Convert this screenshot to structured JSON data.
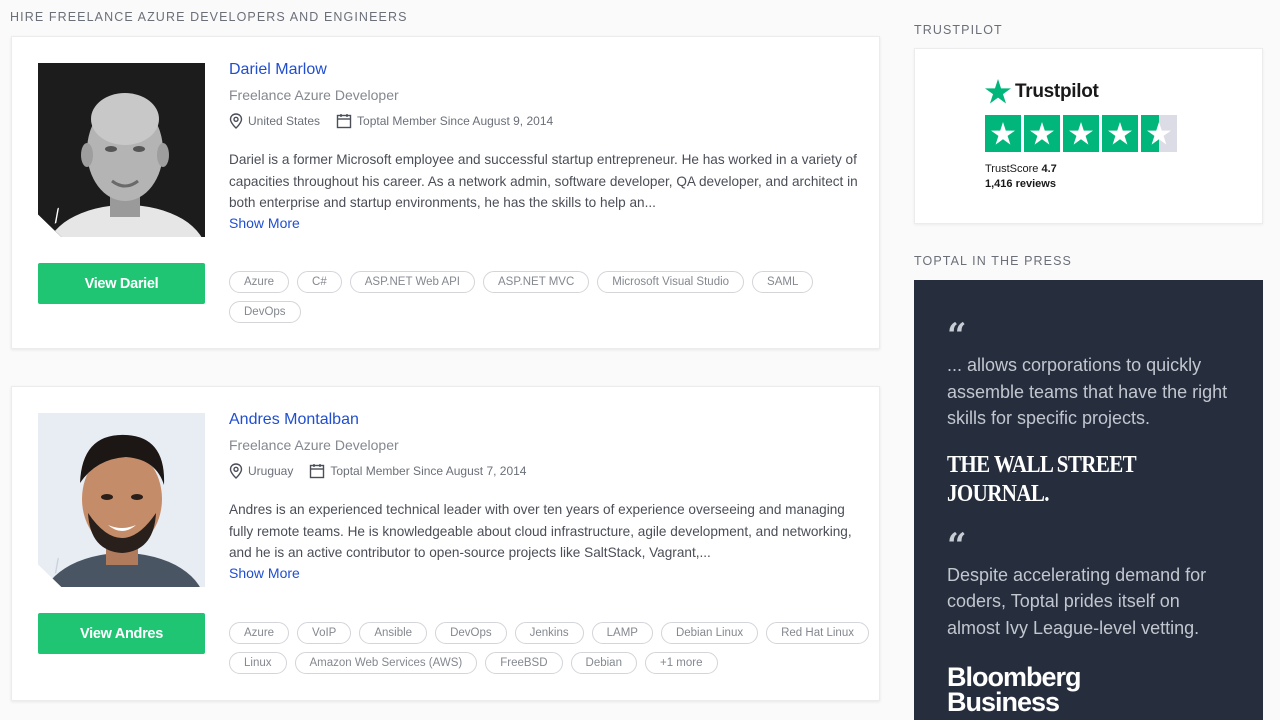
{
  "section_title": "HIRE FREELANCE AZURE DEVELOPERS AND ENGINEERS",
  "developers": [
    {
      "name": "Dariel Marlow",
      "role": "Freelance Azure Developer",
      "location": "United States",
      "member_since": "Toptal Member Since August 9, 2014",
      "description": "Dariel is a former Microsoft employee and successful startup entrepreneur. He has worked in a variety of capacities throughout his career. As a network admin, software developer, QA developer, and architect in both enterprise and startup environments, he has the skills to help an...",
      "show_more": "Show More",
      "button": "View Dariel",
      "skills": [
        "Azure",
        "C#",
        "ASP.NET Web API",
        "ASP.NET MVC",
        "Microsoft Visual Studio",
        "SAML",
        "DevOps"
      ]
    },
    {
      "name": "Andres Montalban",
      "role": "Freelance Azure Developer",
      "location": "Uruguay",
      "member_since": "Toptal Member Since August 7, 2014",
      "description": "Andres is an experienced technical leader with over ten years of experience overseeing and managing fully remote teams. He is knowledgeable about cloud infrastructure, agile development, and networking, and he is an active contributor to open-source projects like SaltStack, Vagrant,...",
      "show_more": "Show More",
      "button": "View Andres",
      "skills": [
        "Azure",
        "VoIP",
        "Ansible",
        "DevOps",
        "Jenkins",
        "LAMP",
        "Debian Linux",
        "Red Hat Linux",
        "Linux",
        "Amazon Web Services (AWS)",
        "FreeBSD",
        "Debian",
        "+1 more"
      ]
    }
  ],
  "trustpilot": {
    "section_title": "TRUSTPILOT",
    "logo_text": "Trustpilot",
    "score_label": "TrustScore",
    "score": "4.7",
    "reviews": "1,416 reviews",
    "rating": 4.5,
    "brand_color": "#00b67a"
  },
  "press": {
    "section_title": "TOPTAL IN THE PRESS",
    "quotes": [
      {
        "mark": "“",
        "text": "... allows corporations to quickly assemble teams that have the right skills for specific projects.",
        "source": "THE WALL STREET JOURNAL."
      },
      {
        "mark": "“",
        "text": "Despite accelerating demand for coders, Toptal prides itself on almost Ivy League-level vetting.",
        "source_line1": "Bloomberg",
        "source_line2": "Business"
      }
    ]
  },
  "colors": {
    "accent_link": "#204ecf",
    "button_green": "#20c573",
    "press_bg": "#262d3d"
  }
}
